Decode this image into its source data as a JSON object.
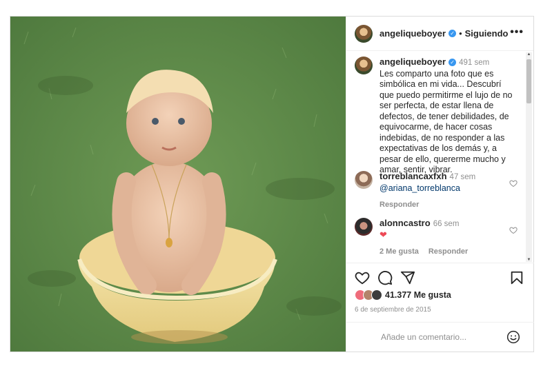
{
  "post": {
    "author": "angeliqueboyer",
    "separator": "•",
    "follow_label": "Siguiendo",
    "more_label": "•••"
  },
  "caption": {
    "author": "angeliqueboyer",
    "time": "491 sem",
    "text": "Les comparto una foto que es simbólica en mi vida... Descubrí que puedo permitirme el lujo de no ser perfecta, de estar llena de defectos, de tener debilidades, de equivocarme, de hacer cosas indebidas, de no responder a las expectativas de los demás y, a pesar de ello, quererme mucho y amar, sentir, vibrar."
  },
  "comments": [
    {
      "user": "torreblancaxfxh",
      "time": "47 sem",
      "text": "@ariana_torreblanca",
      "reply_label": "Responder"
    },
    {
      "user": "alonncastro",
      "time": "66 sem",
      "text": "❤",
      "likes_label": "2 Me gusta",
      "reply_label": "Responder"
    }
  ],
  "actions": {
    "likes": "41.377 Me gusta",
    "date": "6 de septiembre de 2015",
    "comment_placeholder": "Añade un comentario..."
  },
  "icons": [
    "verified-badge-icon",
    "more-icon",
    "heart-icon",
    "comment-icon",
    "share-icon",
    "bookmark-icon",
    "emoji-icon"
  ]
}
